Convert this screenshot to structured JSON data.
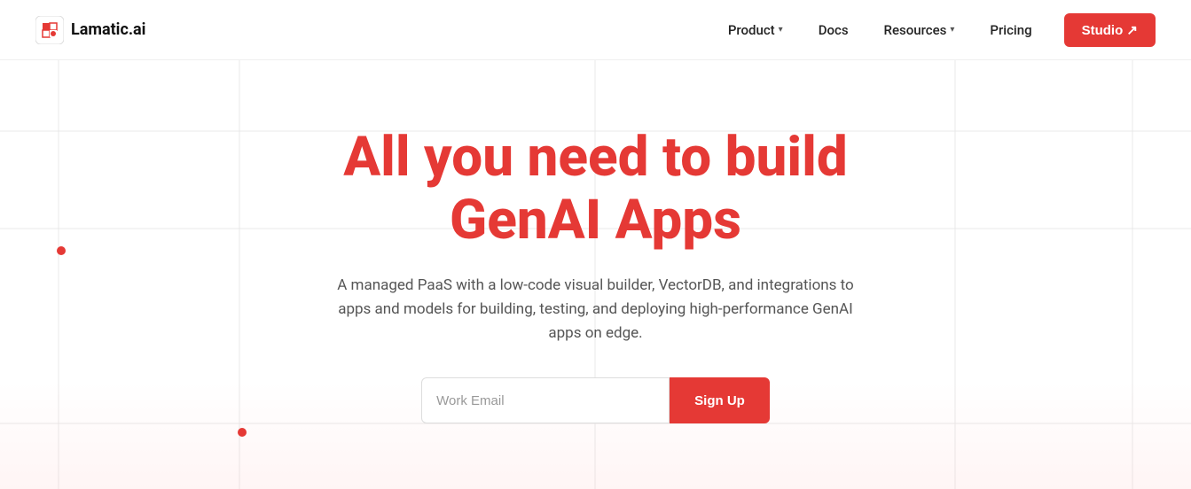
{
  "nav": {
    "logo_text": "Lamatic.ai",
    "items": [
      {
        "label": "Product",
        "has_dropdown": true
      },
      {
        "label": "Docs",
        "has_dropdown": false
      },
      {
        "label": "Resources",
        "has_dropdown": true
      },
      {
        "label": "Pricing",
        "has_dropdown": false
      }
    ],
    "studio_button": "Studio ↗"
  },
  "hero": {
    "title_line1": "All you need to build",
    "title_line2": "GenAI Apps",
    "subtitle": "A managed PaaS with a low-code visual builder, VectorDB, and integrations to apps and models for building, testing, and deploying high-performance GenAI apps on edge.",
    "email_placeholder": "Work Email",
    "signup_label": "Sign Up"
  },
  "colors": {
    "accent": "#e53935",
    "text_dark": "#111",
    "text_muted": "#555"
  }
}
